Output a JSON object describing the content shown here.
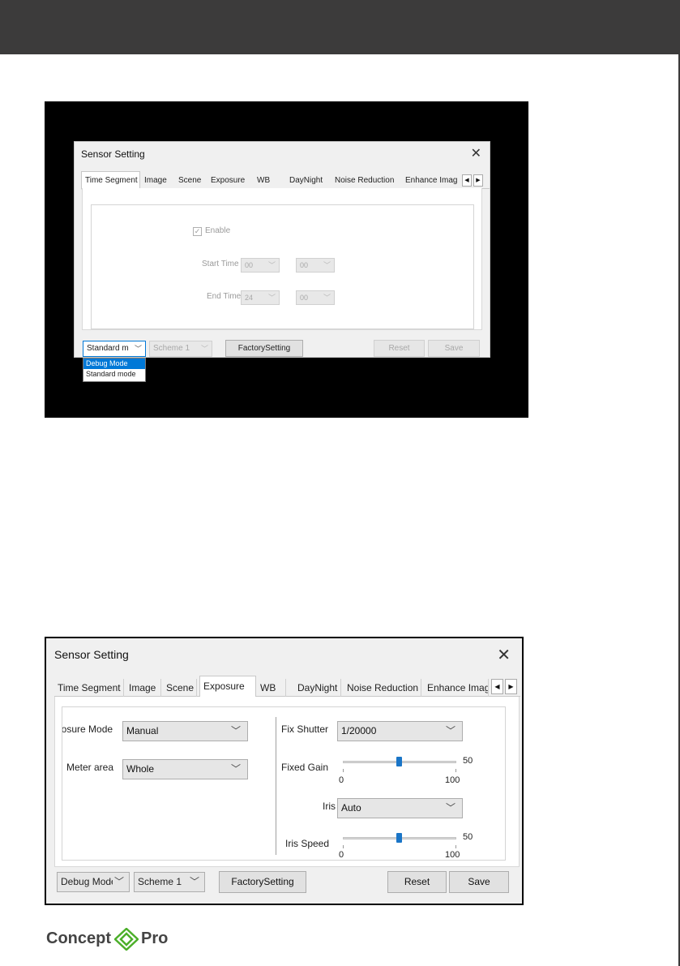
{
  "shot1": {
    "title": "Sensor Setting",
    "close": "✕",
    "tabs": [
      "Time Segment",
      "Image",
      "Scene",
      "Exposure",
      "WB",
      "DayNight",
      "Noise Reduction",
      "Enhance Imag"
    ],
    "active_tab": "Time Segment",
    "enable_label": "Enable",
    "enable_checked": true,
    "start_time_label": "Start Time",
    "start_hour": "00",
    "start_min": "00",
    "end_time_label": "End Time",
    "end_hour": "24",
    "end_min": "00",
    "mode_value": "Standard m",
    "scheme_value": "Scheme 1",
    "factory_label": "FactorySetting",
    "reset_label": "Reset",
    "save_label": "Save",
    "dropdown_options": [
      "Debug Mode",
      "Standard mode"
    ],
    "dropdown_highlighted": "Debug Mode"
  },
  "shot2": {
    "title": "Sensor Setting",
    "close": "✕",
    "tabs": [
      "Time Segment",
      "Image",
      "Scene",
      "Exposure",
      "WB",
      "DayNight",
      "Noise Reduction",
      "Enhance Imag"
    ],
    "active_tab": "Exposure",
    "exposure_mode_label": "xposure Mode",
    "exposure_mode_value": "Manual",
    "meter_area_label": "Meter area",
    "meter_area_value": "Whole",
    "fix_shutter_label": "Fix Shutter",
    "fix_shutter_value": "1/20000",
    "fixed_gain_label": "Fixed Gain",
    "fixed_gain_value": "50",
    "fixed_gain_min": "0",
    "fixed_gain_max": "100",
    "iris_label": "Iris",
    "iris_value": "Auto",
    "iris_speed_label": "Iris Speed",
    "iris_speed_value": "50",
    "iris_speed_min": "0",
    "iris_speed_max": "100",
    "mode_value": "Debug Mode",
    "scheme_value": "Scheme 1",
    "factory_label": "FactorySetting",
    "reset_label": "Reset",
    "save_label": "Save"
  },
  "logo": {
    "left": "Concept",
    "right": "Pro"
  },
  "colors": {
    "header": "#3c3b3b",
    "slider_thumb": "#1a75c7",
    "highlight": "#0078d7"
  }
}
